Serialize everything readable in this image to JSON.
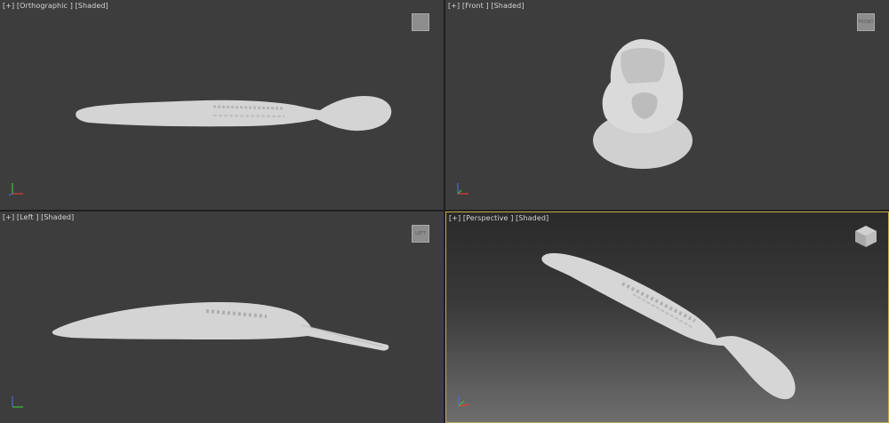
{
  "viewports": [
    {
      "id": "top",
      "label": {
        "plus": "[+]",
        "view": "[Orthographic ]",
        "shading": "[Shaded]"
      },
      "cube_text": "",
      "active": false
    },
    {
      "id": "front",
      "label": {
        "plus": "[+]",
        "view": "[Front ]",
        "shading": "[Shaded]"
      },
      "cube_text": "FRONT",
      "active": false
    },
    {
      "id": "left",
      "label": {
        "plus": "[+]",
        "view": "[Left ]",
        "shading": "[Shaded]"
      },
      "cube_text": "LEFT",
      "active": false
    },
    {
      "id": "perspective",
      "label": {
        "plus": "[+]",
        "view": "[Perspective ]",
        "shading": "[Shaded]"
      },
      "cube_text": "",
      "active": true
    }
  ],
  "colors": {
    "viewport_bg": "#3d3d3d",
    "active_border": "#c8a84e",
    "model": "#d4d4d4",
    "axis_x": "#e03c3c",
    "axis_y": "#3cc03c",
    "axis_z": "#4a6cd6"
  },
  "icons": {
    "viewcube": "viewcube-icon",
    "axis_tripod": "axis-tripod-icon",
    "model": "fishing-lure-model"
  }
}
